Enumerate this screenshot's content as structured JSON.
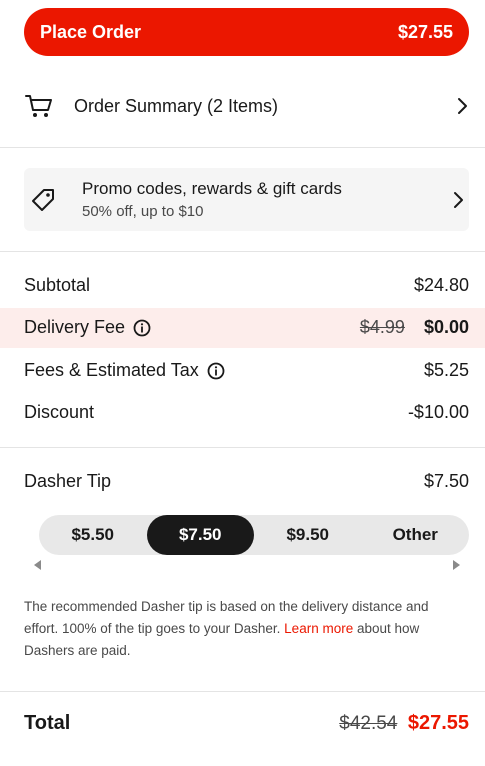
{
  "place_order": {
    "label": "Place Order",
    "amount": "$27.55"
  },
  "order_summary": {
    "label": "Order Summary (2 Items)",
    "icon": "cart-icon"
  },
  "promo": {
    "title": "Promo codes, rewards & gift cards",
    "subtitle": "50% off, up to $10",
    "icon": "tag-icon"
  },
  "breakdown": {
    "subtotal": {
      "label": "Subtotal",
      "value": "$24.80"
    },
    "delivery_fee": {
      "label": "Delivery Fee",
      "original": "$4.99",
      "value": "$0.00"
    },
    "fees_tax": {
      "label": "Fees & Estimated Tax",
      "value": "$5.25"
    },
    "discount": {
      "label": "Discount",
      "value": "-$10.00"
    }
  },
  "tip": {
    "label": "Dasher Tip",
    "value": "$7.50",
    "options": [
      "$5.50",
      "$7.50",
      "$9.50",
      "Other"
    ],
    "selected_index": 1,
    "note_before": "The recommended Dasher tip is based on the delivery distance and effort. 100% of the tip goes to your Dasher. ",
    "note_link": "Learn more",
    "note_after": " about how Dashers are paid."
  },
  "total": {
    "label": "Total",
    "original": "$42.54",
    "value": "$27.55"
  },
  "colors": {
    "brand_red": "#eb1700",
    "fee_highlight": "#fdedeb",
    "selected_tip": "#191919"
  }
}
